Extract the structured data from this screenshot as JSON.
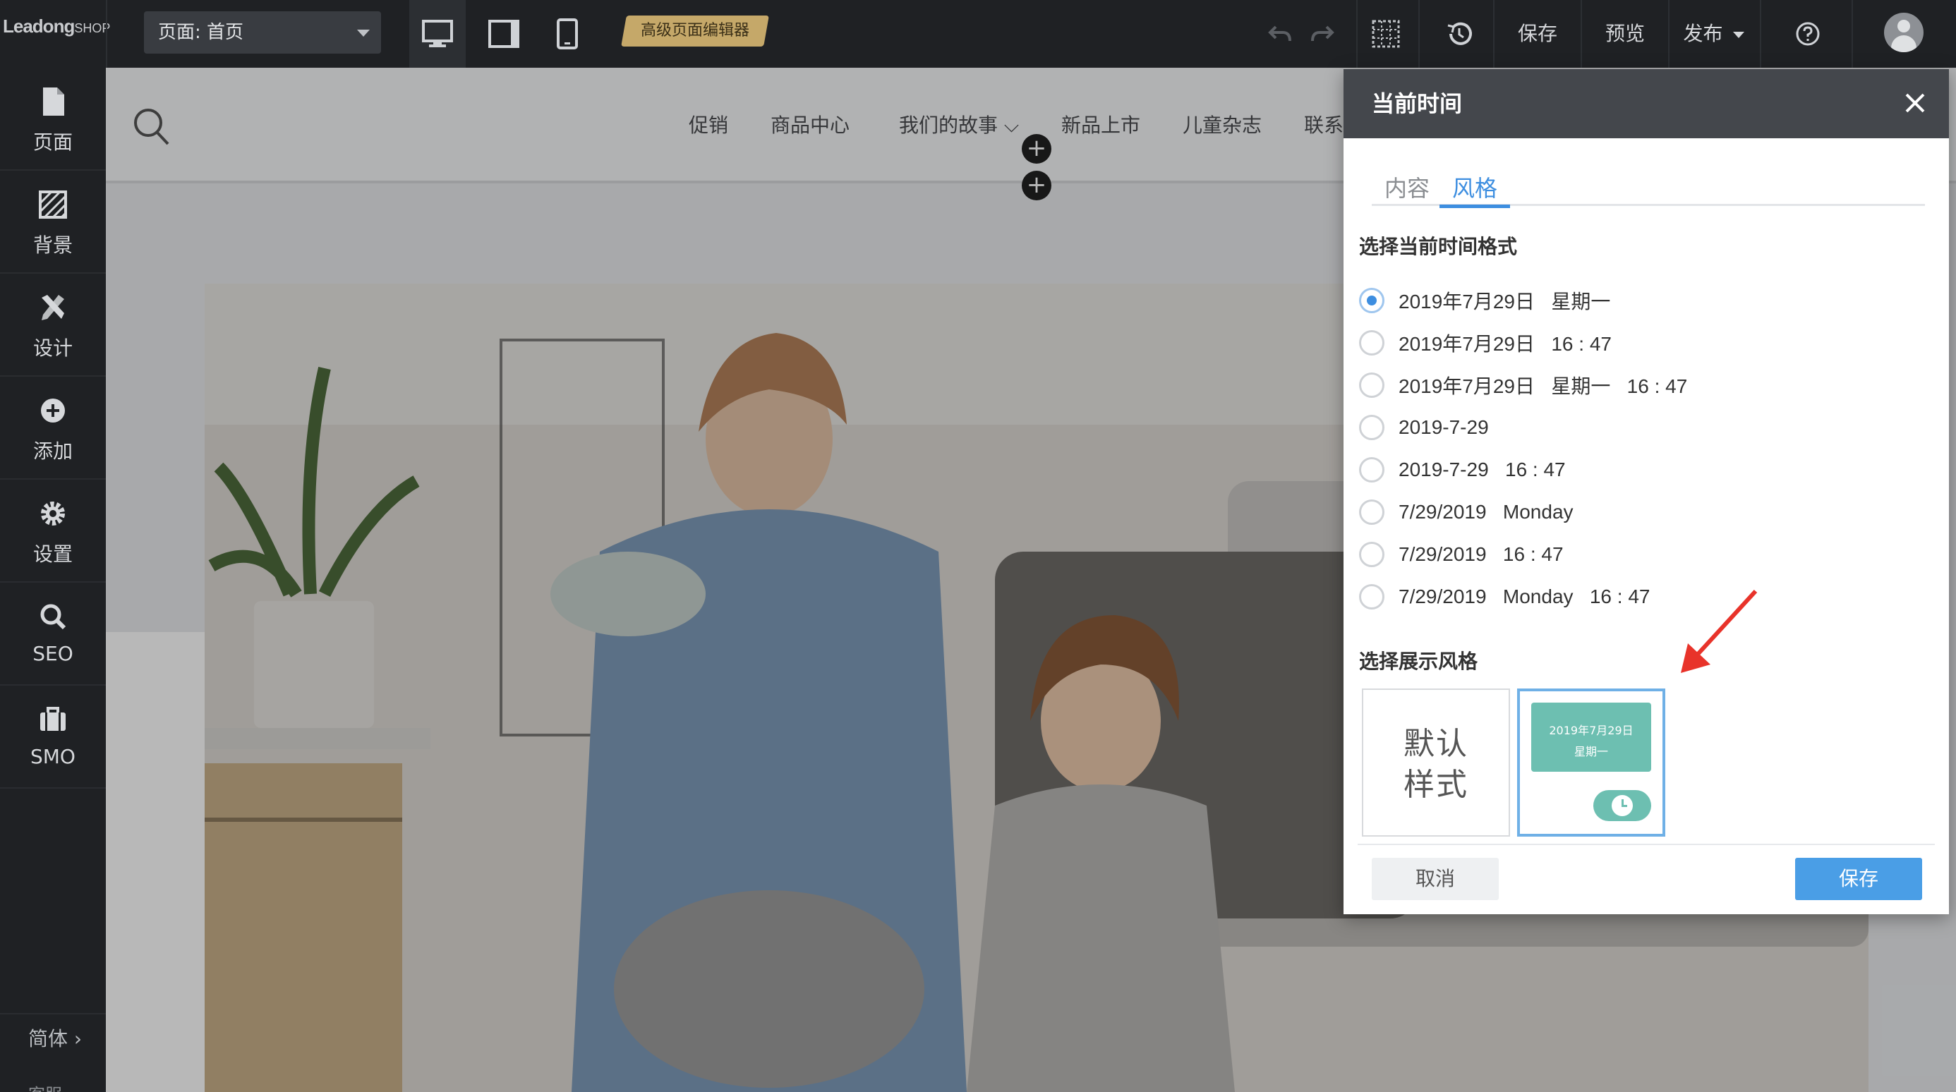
{
  "app": {
    "logo_text": "LeadongSHOP",
    "logo_main": "Leadong",
    "logo_shop": "SHOP",
    "page_selector": "页面:  首页",
    "advanced_editor_badge": "高级页面编辑器",
    "toolbar": {
      "save_label": "保存",
      "preview_label": "预览",
      "publish_label": "发布"
    },
    "device_modes": [
      "desktop-icon",
      "tablet-icon",
      "mobile-icon"
    ],
    "active_device": "desktop"
  },
  "sidebar": {
    "items": [
      {
        "label": "页面",
        "icon": "page-icon"
      },
      {
        "label": "背景",
        "icon": "background-icon"
      },
      {
        "label": "设计",
        "icon": "design-icon"
      },
      {
        "label": "添加",
        "icon": "add-icon"
      },
      {
        "label": "设置",
        "icon": "settings-icon"
      },
      {
        "label": "SEO",
        "icon": "search-icon"
      },
      {
        "label": "SMO",
        "icon": "briefcase-icon"
      }
    ],
    "language": "简体  ›",
    "bottom_partial": "客服"
  },
  "site": {
    "nav": [
      {
        "label": "促销"
      },
      {
        "label": "商品中心"
      },
      {
        "label": "我们的故事 ⌵"
      },
      {
        "label": "新品上市"
      },
      {
        "label": "儿童杂志"
      },
      {
        "label": "联系"
      }
    ]
  },
  "dialog": {
    "title": "当前时间",
    "tabs": [
      {
        "label": "内容",
        "active": false
      },
      {
        "label": "风格",
        "active": true
      }
    ],
    "format_section_title": "选择当前时间格式",
    "formats": [
      {
        "label": "2019年7月29日   星期一",
        "checked": true
      },
      {
        "label": "2019年7月29日   16 : 47",
        "checked": false
      },
      {
        "label": "2019年7月29日   星期一   16 : 47",
        "checked": false
      },
      {
        "label": "2019-7-29",
        "checked": false
      },
      {
        "label": "2019-7-29   16 : 47",
        "checked": false
      },
      {
        "label": "7/29/2019   Monday",
        "checked": false
      },
      {
        "label": "7/29/2019   16 : 47",
        "checked": false
      },
      {
        "label": "7/29/2019   Monday   16 : 47",
        "checked": false
      }
    ],
    "style_section_title": "选择展示风格",
    "styles": {
      "default_line1": "默认",
      "default_line2": "样式",
      "preview_date": "2019年7月29日",
      "preview_weekday": "星期一"
    },
    "cancel_label": "取消",
    "save_label": "保存"
  },
  "colors": {
    "accent": "#3d8ee0",
    "preview_teal": "#6dbfb1",
    "badge_gold": "#c5a869",
    "annotation_red": "#e8332a"
  }
}
